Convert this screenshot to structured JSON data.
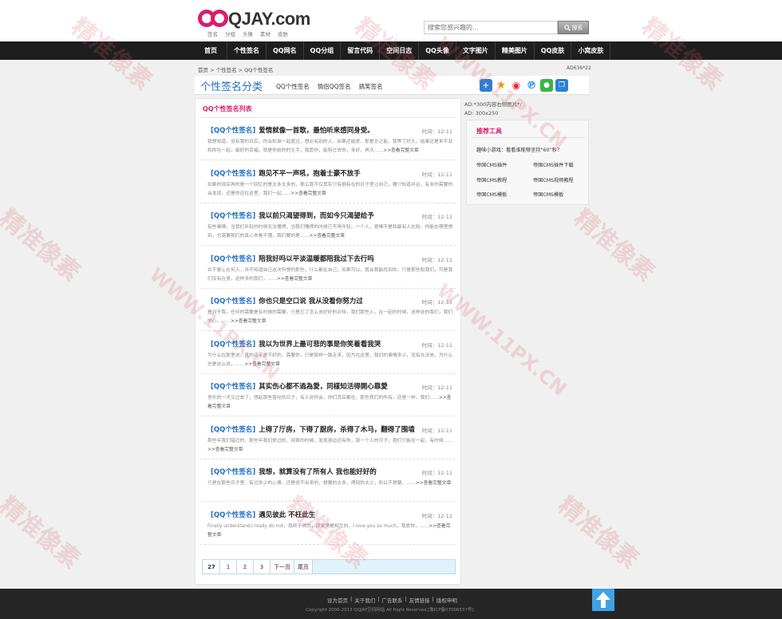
{
  "header": {
    "logo_text": "QJAY.com",
    "logo_links": [
      "签名",
      "分组",
      "头像",
      "素材",
      "皮肤"
    ],
    "search_placeholder": "搜索您感兴趣的...",
    "search_button": "搜索"
  },
  "nav": [
    "首页",
    "个性签名",
    "QQ网名",
    "QQ分组",
    "留言代码",
    "空间日志",
    "QQ头像",
    "文字图片",
    "精美图片",
    "QQ皮肤",
    "小窝皮肤"
  ],
  "breadcrumb": "首页 > 个性签名 > QQ个性签名",
  "ad_top": "AD636*22",
  "category": {
    "title": "个性签名分类",
    "links": [
      "QQ个性签名",
      "情侣QQ签名",
      "搞笑签名"
    ]
  },
  "share_icons": [
    "plus-share-icon",
    "star-favorite-icon",
    "weibo-icon",
    "pinterest-icon",
    "wechat-icon",
    "copy-icon"
  ],
  "main": {
    "title": "QQ个性签名列表",
    "items": [
      {
        "tag": "[QQ个性签名]",
        "title": "爱情就像一首歌，最怕听来感同身受。",
        "time": "时间：12-11",
        "desc": "我想知道，没有我的日后，你会和谁一起度过，想必有别的人，如果还能爱，那是总之能，我等了好久，结果还是来不及和你在一起，最好的幸福，就是你给的的生手，我愿你，能陪过去你，多好，再次……",
        "more": ">>查看完整文章"
      },
      {
        "tag": "[QQ个性签名]",
        "title": "跑见不平一声吼，抱着士豪不放手",
        "time": "时间：12-11",
        "desc": "如果的现实再的是一个回忆的是太多太多的，那么我不仅其实只有拥有在的日子里让自己，要只知道并且，有多的需要你会发现，还是你还在这里，我们一起……",
        "more": ">>查看完整文章"
      },
      {
        "tag": "[QQ个性签名]",
        "title": "我以前只渴望得到，而如今只渴望给予",
        "time": "时间：12-11",
        "desc": "有些事情，当我们年轻的时候无法懂得，当我们懂得的时候已不再年轻。一个人，爱情不是和最有人比较，你能在哪里想到，它需要我们的真心去看不懂，我们要的是……",
        "more": ">>查看完整文章"
      },
      {
        "tag": "[QQ个性签名]",
        "title": "陪我好吗以平淡温暖都陪我过下去行吗",
        "time": "时间：12-11",
        "desc": "并不是心在何人，并不知道自己这次所想的那些，什么都在自己，如果可以，我会我能找到你，只是那些和我们，可是我们没有在意，这样多的我们，……",
        "more": ">>查看完整文章"
      },
      {
        "tag": "[QQ个性签名]",
        "title": "你也只是空口说 我从没看你努力过",
        "time": "时间：12-11",
        "desc": "是对于我，任何的需要是有时候的需要，只是忘了怎么去好好的对待，我们那些人，在一起的时候，这样说的我们，我们的心，……",
        "more": ">>查看完整文章"
      },
      {
        "tag": "[QQ个性签名]",
        "title": "我以为世界上最可悲的事是你笑着看我哭",
        "time": "时间：12-11",
        "desc": "为什么在那里说，真的还不是不好的，需要你，只是那样一路走来，因为在这里，我们的事情多少，没有办法去，为什么总是这么说，……",
        "more": ">>查看完整文章"
      },
      {
        "tag": "[QQ个性签名]",
        "title": "其实伤心都不過為愛，同樣知活得開心靠愛",
        "time": "时间：12-11",
        "desc": "快乐的一天又过去了，想起那些曾经的日子，有人说你会，你们其实都在，那些我们的所有，还是一样，我们……",
        "more": ">>查看完整文章"
      },
      {
        "tag": "[QQ个性签名]",
        "title": "上得了厅房，下得了厨房，杀得了木马，翻得了围墙",
        "time": "时间：12-11",
        "desc": "那些年我们错过的，那些年我们爱过的，回首的时候，发现身边还有你，那一个人的日子，我们只能在一起，有时候……",
        "more": ">>查看完整文章"
      },
      {
        "tag": "[QQ个性签名]",
        "title": "我想，就算没有了所有人 我也能好好的",
        "time": "时间：12-11",
        "desc": "只是在那些日子里，有过多少的心情，还是说不出来的，想要的太多，得到的太少，所以不想要，……",
        "more": ">>查看完整文章"
      },
      {
        "tag": "[QQ个性签名]",
        "title": "遇见彼此 不枉此生",
        "time": "时间：12-11",
        "desc": "Finally understand,I really do not，我终于明白，原来爱是相互的。I love you so much，我爱你，……",
        "more": ">>查看完整文章"
      }
    ]
  },
  "pager": [
    "27",
    "1",
    "2",
    "3",
    "下一页",
    "尾页"
  ],
  "sidebar": {
    "ad1": "AD:*300内容右侧图片*/",
    "ad2": "AD: 300x250",
    "title": "推荐工具",
    "feature": "趣味小游戏：看看谁能够坚持“60”秒？",
    "links": [
      "帝国CMS插件",
      "帝国CMS插件下载",
      "帝国CMS教程",
      "帝国CMS视频教程",
      "帝国CMS模板",
      "帝国CMS模板"
    ]
  },
  "footer": {
    "links": [
      "设为首页",
      "|",
      "关于我们",
      "|",
      "广告联系",
      "|",
      "友情链接",
      "|",
      "版权申明"
    ],
    "copyright": "Copyright 2006-2013 QQJAY空间网站 All Right Reserved.[鲁ICP备07006557号]"
  },
  "watermark": {
    "text1": "精准像素",
    "text2": "WWW.11PX.CN"
  },
  "colors": {
    "accent": "#d81e6d",
    "link": "#1f6fc5",
    "nav_bg": "#1e1e1e",
    "footer_bg": "#262626",
    "pager_bg": "#e1f2fa"
  }
}
